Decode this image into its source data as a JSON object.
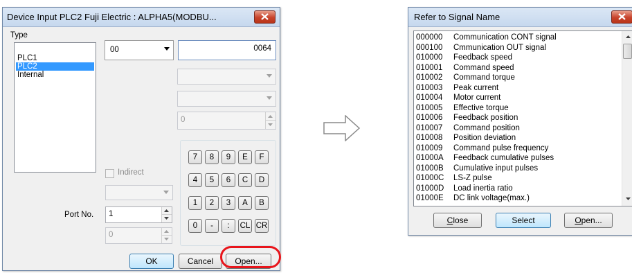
{
  "device_input": {
    "title": "Device Input  PLC2 Fuji Electric : ALPHA5(MODBU...",
    "type_label": "Type",
    "type_items": [
      {
        "label": "PLC1",
        "selected": false
      },
      {
        "label": "PLC2",
        "selected": true
      },
      {
        "label": "Internal",
        "selected": false
      }
    ],
    "device_combo_value": "00",
    "address_value": "0064",
    "numeric_value": "0",
    "indirect_label": "Indirect",
    "port_label": "Port No.",
    "port_value": "1",
    "sub_value": "0",
    "keypad_rows": [
      [
        "7",
        "8",
        "9",
        "E",
        "F"
      ],
      [
        "4",
        "5",
        "6",
        "C",
        "D"
      ],
      [
        "1",
        "2",
        "3",
        "A",
        "B"
      ],
      [
        "0",
        "-",
        ":",
        "CL",
        "CR"
      ]
    ],
    "ok_label": "OK",
    "cancel_label": "Cancel",
    "open_label": "Open..."
  },
  "refer_signal": {
    "title": "Refer to Signal Name",
    "signals": [
      {
        "code": "000000",
        "name": "Communication CONT signal"
      },
      {
        "code": "000100",
        "name": "Cmmunication OUT signal"
      },
      {
        "code": "010000",
        "name": "Feedback speed"
      },
      {
        "code": "010001",
        "name": "Command speed"
      },
      {
        "code": "010002",
        "name": "Command torque"
      },
      {
        "code": "010003",
        "name": "Peak current"
      },
      {
        "code": "010004",
        "name": "Motor current"
      },
      {
        "code": "010005",
        "name": "Effective torque"
      },
      {
        "code": "010006",
        "name": "Feedback position"
      },
      {
        "code": "010007",
        "name": "Command position"
      },
      {
        "code": "010008",
        "name": "Position deviation"
      },
      {
        "code": "010009",
        "name": "Command pulse frequency"
      },
      {
        "code": "01000A",
        "name": "Feedback cumulative pulses"
      },
      {
        "code": "01000B",
        "name": "Cumulative input pulses"
      },
      {
        "code": "01000C",
        "name": "LS-Z pulse"
      },
      {
        "code": "01000D",
        "name": "Load inertia ratio"
      },
      {
        "code": "01000E",
        "name": "DC link voltage(max.)"
      }
    ],
    "close_label": "Close",
    "select_label": "Select",
    "open_label": "Open..."
  },
  "colors": {
    "highlight_ring": "#e8151b",
    "selection": "#3399ff"
  },
  "icons": {
    "close": "close-x-icon",
    "arrow": "right-arrow-icon"
  }
}
